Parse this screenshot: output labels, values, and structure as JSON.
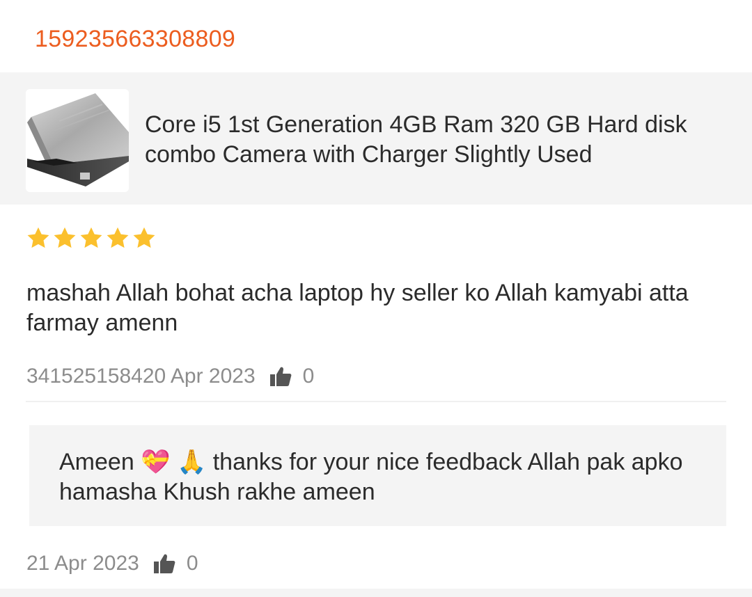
{
  "order": {
    "id": "159235663308809"
  },
  "product": {
    "title": "Core i5 1st Generation 4GB Ram 320 GB Hard disk combo Camera with Charger  Slightly Used",
    "thumbnail_icon": "laptop-image"
  },
  "review": {
    "rating": 5,
    "rating_max": 5,
    "star_color": "#fbc02d",
    "text": "mashah Allah bohat acha laptop hy seller ko Allah kamyabi atta farmay amenn",
    "meta": "341525158420 Apr 2023",
    "like_count": "0"
  },
  "reply": {
    "text": "Ameen 💝 🙏 thanks for your nice feedback Allah pak apko hamasha Khush rakhe ameen",
    "date": "21 Apr 2023",
    "like_count": "0"
  },
  "colors": {
    "accent": "#ec5d1f",
    "panel_bg": "#f4f4f4",
    "meta_text": "#8c8c8c"
  }
}
